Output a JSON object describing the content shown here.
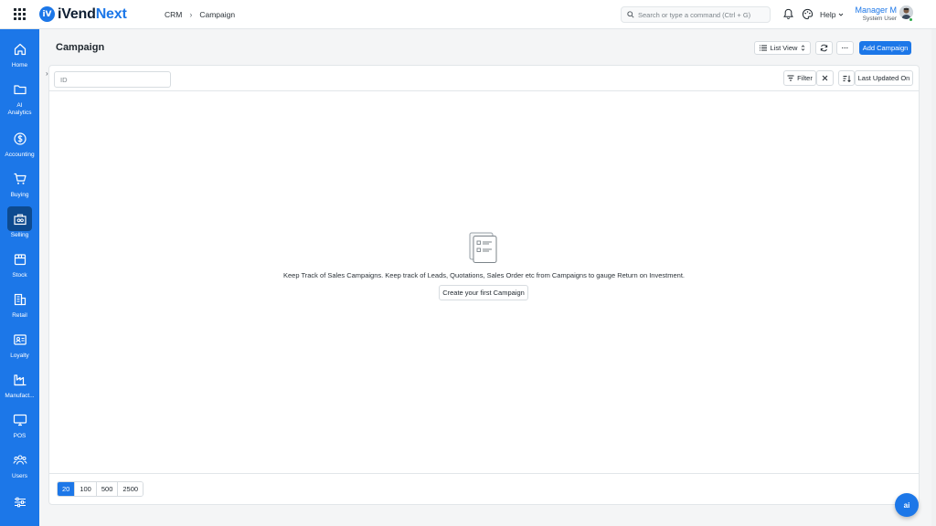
{
  "app": {
    "logo_text_a": "iVend",
    "logo_text_b": "Next",
    "logo_mark": "iV"
  },
  "breadcrumb": {
    "items": [
      "CRM",
      "Campaign"
    ],
    "separator": "›"
  },
  "search": {
    "placeholder": "Search or type a command (Ctrl + G)"
  },
  "header": {
    "help_label": "Help",
    "user_name": "Manager M",
    "user_role": "System User"
  },
  "sidebar": {
    "items": [
      {
        "label": "Home",
        "icon": "home-icon"
      },
      {
        "label": "AI Analytics",
        "icon": "folder-icon"
      },
      {
        "label": "Accounting",
        "icon": "dollar-icon"
      },
      {
        "label": "Buying",
        "icon": "cart-icon"
      },
      {
        "label": "Selling",
        "icon": "store-icon",
        "active": true
      },
      {
        "label": "Stock",
        "icon": "box-icon"
      },
      {
        "label": "Retail",
        "icon": "building-icon"
      },
      {
        "label": "Loyalty",
        "icon": "id-card-icon"
      },
      {
        "label": "Manufact...",
        "icon": "factory-icon"
      },
      {
        "label": "POS",
        "icon": "monitor-icon"
      },
      {
        "label": "Users",
        "icon": "users-icon"
      },
      {
        "label": "",
        "icon": "sliders-icon"
      }
    ]
  },
  "page": {
    "title": "Campaign",
    "list_view_label": "List View",
    "more_label": "···",
    "add_label": "Add Campaign"
  },
  "filters": {
    "id_placeholder": "ID",
    "filter_label": "Filter",
    "sort_label": "Last Updated On"
  },
  "empty_state": {
    "message": "Keep Track of Sales Campaigns. Keep track of Leads, Quotations, Sales Order etc from Campaigns to gauge Return on Investment.",
    "button_label": "Create your first Campaign"
  },
  "paging": {
    "options": [
      "20",
      "100",
      "500",
      "2500"
    ],
    "selected": "20"
  },
  "ai_button": {
    "label": "ai"
  },
  "colors": {
    "accent": "#1c77e8",
    "sidebar_active": "#0d4a8f",
    "background": "#f4f5f6"
  }
}
